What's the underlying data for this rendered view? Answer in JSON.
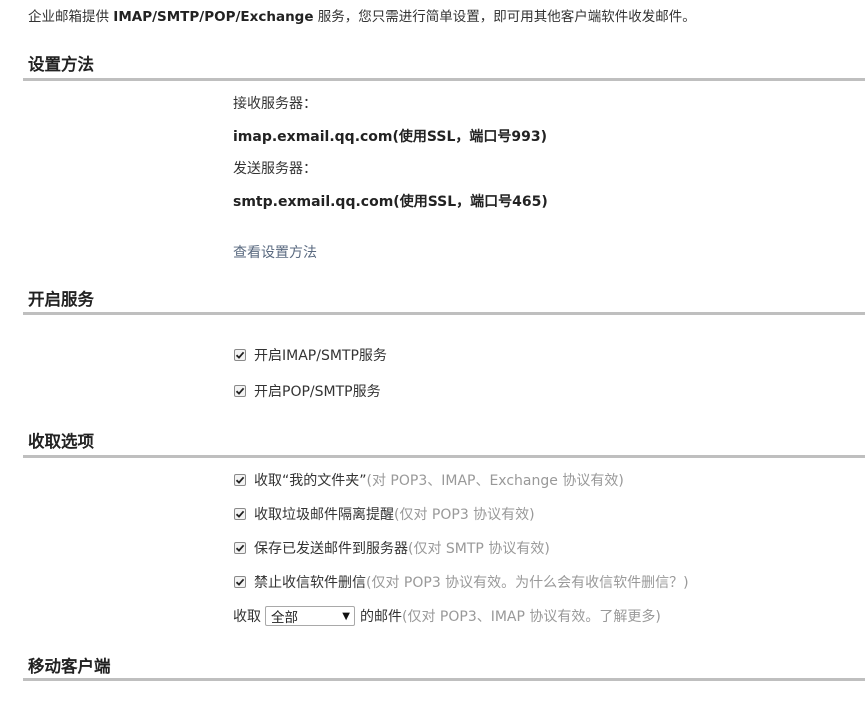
{
  "intro": {
    "prefix": "企业邮箱提供 ",
    "protocols": "IMAP/SMTP/POP/Exchange",
    "suffix": " 服务，您只需进行简单设置，即可用其他客户端软件收发邮件。"
  },
  "settings": {
    "title": "设置方法",
    "incoming_label": "接收服务器：",
    "incoming_value": "imap.exmail.qq.com(使用SSL，端口号993)",
    "outgoing_label": "发送服务器：",
    "outgoing_value": "smtp.exmail.qq.com(使用SSL，端口号465)",
    "view_link": "查看设置方法"
  },
  "services": {
    "title": "开启服务",
    "items": [
      {
        "label": "开启IMAP/SMTP服务",
        "checked": true
      },
      {
        "label": "开启POP/SMTP服务",
        "checked": true
      }
    ]
  },
  "fetch": {
    "title": "收取选项",
    "items": [
      {
        "label": "收取“我的文件夹”",
        "note": " (对 POP3、IMAP、Exchange 协议有效)",
        "checked": true
      },
      {
        "label": "收取垃圾邮件隔离提醒",
        "note": " (仅对 POP3 协议有效)",
        "checked": true
      },
      {
        "label": "保存已发送邮件到服务器",
        "note": " (仅对 SMTP 协议有效)",
        "checked": true
      },
      {
        "label": "禁止收信软件删信",
        "note": " (仅对 POP3 协议有效。为什么会有收信软件删信？)",
        "checked": true
      }
    ],
    "range_prefix": "收取",
    "range_selected": "全部",
    "range_suffix": "的邮件",
    "range_note": " (仅对 POP3、IMAP 协议有效。了解更多)"
  },
  "mobile": {
    "title": "移动客户端"
  },
  "colors": {
    "rule": "#bfbfbf",
    "note": "#999999",
    "link": "#5a6a80"
  }
}
